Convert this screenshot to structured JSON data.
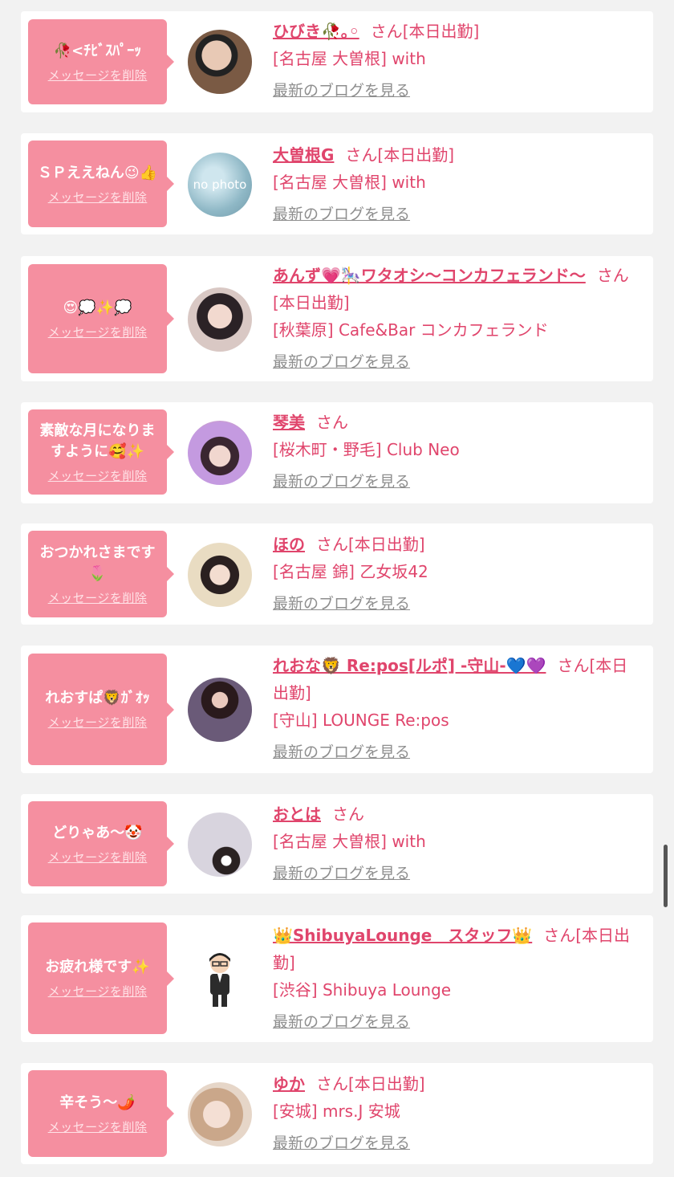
{
  "delete_label": "メッセージを削除",
  "blog_label": "最新のブログを見る",
  "san_suffix": "さん",
  "cards": [
    {
      "message": "🥀<ﾁﾋﾞｽﾊﾟｰｯ",
      "name": "ひびき🥀｡◦",
      "status": "[本日出勤]",
      "shop": "[名古屋 大曽根] with",
      "avatar": "photo"
    },
    {
      "message": "ＳＰええねん😉👍",
      "name": "大曽根G",
      "status": "[本日出勤]",
      "shop": "[名古屋 大曽根] with",
      "avatar": "no photo"
    },
    {
      "message": "😍💭✨💭",
      "name": "あんず💗🎠ワタオシ〜コンカフェランド〜",
      "status": "[本日出勤]",
      "shop": "[秋葉原] Cafe&Bar コンカフェランド",
      "avatar": "photo"
    },
    {
      "message": "素敵な月になりますように🥰✨",
      "name": "琴美",
      "status": "",
      "shop": "[桜木町・野毛] Club Neo",
      "avatar": "photo"
    },
    {
      "message": "おつかれさまです🌷",
      "name": "ほの",
      "status": "[本日出勤]",
      "shop": "[名古屋 錦] 乙女坂42",
      "avatar": "photo"
    },
    {
      "message": "れおすぱ🦁ｶﾞｵｯ",
      "name": "れおな🦁 Re:pos[ルポ] -守山-💙💜",
      "status": "[本日出勤]",
      "shop": "[守山] LOUNGE Re:pos",
      "avatar": "photo"
    },
    {
      "message": "どりゃあ〜🤡",
      "name": "おとは",
      "status": "",
      "shop": "[名古屋 大曽根] with",
      "avatar": "photo"
    },
    {
      "message": "お疲れ様です✨",
      "name": "👑ShibuyaLounge　スタッフ👑",
      "status": "[本日出勤]",
      "shop": "[渋谷] Shibuya Lounge",
      "avatar": "illustration"
    },
    {
      "message": "辛そう〜🌶️",
      "name": "ゆか",
      "status": "[本日出勤]",
      "shop": "[安城] mrs.J 安城",
      "avatar": "photo"
    }
  ]
}
